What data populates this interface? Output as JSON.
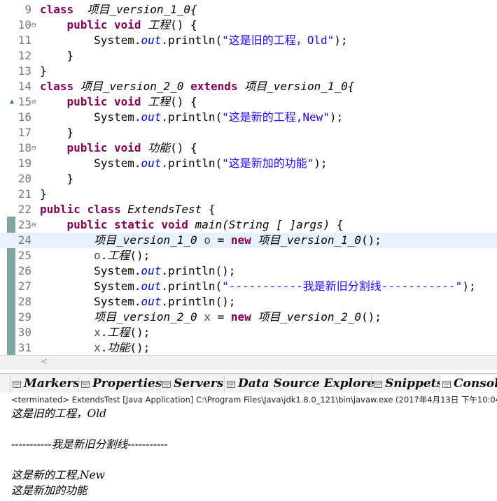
{
  "editor": {
    "lines": [
      {
        "n": "9",
        "fold": "",
        "segs": [
          [
            "kw",
            "class"
          ],
          [
            "",
            "  "
          ],
          [
            "it",
            "项目_version_1_0{"
          ]
        ]
      },
      {
        "n": "10",
        "fold": "⊖",
        "segs": [
          [
            "",
            "    "
          ],
          [
            "kw",
            "public"
          ],
          [
            "",
            " "
          ],
          [
            "kw",
            "void"
          ],
          [
            "",
            " "
          ],
          [
            "it",
            "工程"
          ],
          [
            "",
            "() {"
          ]
        ]
      },
      {
        "n": "11",
        "fold": "",
        "segs": [
          [
            "",
            "        System."
          ],
          [
            "fd",
            "out"
          ],
          [
            "",
            ".println("
          ],
          [
            "st",
            "\"这是旧的工程，Old\""
          ],
          [
            "",
            ");"
          ]
        ]
      },
      {
        "n": "12",
        "fold": "",
        "segs": [
          [
            "",
            "    }"
          ]
        ]
      },
      {
        "n": "13",
        "fold": "",
        "segs": [
          [
            "",
            "}"
          ]
        ]
      },
      {
        "n": "14",
        "fold": "",
        "segs": [
          [
            "kw",
            "class"
          ],
          [
            "",
            " "
          ],
          [
            "it",
            "项目_version_2_0"
          ],
          [
            "",
            " "
          ],
          [
            "kw",
            "extends"
          ],
          [
            "",
            " "
          ],
          [
            "it",
            "项目_version_1_0{"
          ]
        ]
      },
      {
        "n": "15",
        "fold": "⊖",
        "up": true,
        "segs": [
          [
            "",
            "    "
          ],
          [
            "kw",
            "public"
          ],
          [
            "",
            " "
          ],
          [
            "kw",
            "void"
          ],
          [
            "",
            " "
          ],
          [
            "it",
            "工程"
          ],
          [
            "",
            "() {"
          ]
        ]
      },
      {
        "n": "16",
        "fold": "",
        "segs": [
          [
            "",
            "        System."
          ],
          [
            "fd",
            "out"
          ],
          [
            "",
            ".println("
          ],
          [
            "st",
            "\"这是新的工程,New\""
          ],
          [
            "",
            ");"
          ]
        ]
      },
      {
        "n": "17",
        "fold": "",
        "segs": [
          [
            "",
            "    }"
          ]
        ]
      },
      {
        "n": "18",
        "fold": "⊖",
        "segs": [
          [
            "",
            "    "
          ],
          [
            "kw",
            "public"
          ],
          [
            "",
            " "
          ],
          [
            "kw",
            "void"
          ],
          [
            "",
            " "
          ],
          [
            "it",
            "功能"
          ],
          [
            "",
            "() {"
          ]
        ]
      },
      {
        "n": "19",
        "fold": "",
        "segs": [
          [
            "",
            "        System."
          ],
          [
            "fd",
            "out"
          ],
          [
            "",
            ".println("
          ],
          [
            "st",
            "\"这是新加的功能\""
          ],
          [
            "",
            ");"
          ]
        ]
      },
      {
        "n": "20",
        "fold": "",
        "segs": [
          [
            "",
            "    }"
          ]
        ]
      },
      {
        "n": "21",
        "fold": "",
        "segs": [
          [
            "",
            "}"
          ]
        ]
      },
      {
        "n": "22",
        "fold": "",
        "segs": [
          [
            "kw",
            "public"
          ],
          [
            "",
            " "
          ],
          [
            "kw",
            "class"
          ],
          [
            "",
            " "
          ],
          [
            "it",
            "ExtendsTest"
          ],
          [
            "",
            " {"
          ]
        ]
      },
      {
        "n": "23",
        "fold": "⊖",
        "segs": [
          [
            "",
            "    "
          ],
          [
            "kw",
            "public"
          ],
          [
            "",
            " "
          ],
          [
            "kw",
            "static"
          ],
          [
            "",
            " "
          ],
          [
            "kw",
            "void"
          ],
          [
            "",
            " "
          ],
          [
            "it",
            "main(String [ ]args)"
          ],
          [
            "",
            " {"
          ]
        ]
      },
      {
        "n": "24",
        "fold": "",
        "current": true,
        "segs": [
          [
            "",
            "        "
          ],
          [
            "it",
            "项目_version_1_0"
          ],
          [
            "",
            " "
          ],
          [
            "lv",
            "o"
          ],
          [
            "",
            " = "
          ],
          [
            "kw",
            "new"
          ],
          [
            "",
            " "
          ],
          [
            "it",
            "项目_version_1_0"
          ],
          [
            "",
            "();"
          ]
        ]
      },
      {
        "n": "25",
        "fold": "",
        "segs": [
          [
            "",
            "        "
          ],
          [
            "lv",
            "o"
          ],
          [
            "",
            "."
          ],
          [
            "it",
            "工程"
          ],
          [
            "",
            "();"
          ]
        ]
      },
      {
        "n": "26",
        "fold": "",
        "segs": [
          [
            "",
            "        System."
          ],
          [
            "fd",
            "out"
          ],
          [
            "",
            ".println();"
          ]
        ]
      },
      {
        "n": "27",
        "fold": "",
        "segs": [
          [
            "",
            "        System."
          ],
          [
            "fd",
            "out"
          ],
          [
            "",
            ".println("
          ],
          [
            "st",
            "\"-----------我是新旧分割线-----------\""
          ],
          [
            "",
            ");"
          ]
        ]
      },
      {
        "n": "28",
        "fold": "",
        "segs": [
          [
            "",
            "        System."
          ],
          [
            "fd",
            "out"
          ],
          [
            "",
            ".println();"
          ]
        ]
      },
      {
        "n": "29",
        "fold": "",
        "segs": [
          [
            "",
            "        "
          ],
          [
            "it",
            "项目_version_2_0"
          ],
          [
            "",
            " "
          ],
          [
            "lv",
            "x"
          ],
          [
            "",
            " = "
          ],
          [
            "kw",
            "new"
          ],
          [
            "",
            " "
          ],
          [
            "it",
            "项目_version_2_0"
          ],
          [
            "",
            "();"
          ]
        ]
      },
      {
        "n": "30",
        "fold": "",
        "segs": [
          [
            "",
            "        "
          ],
          [
            "lv",
            "x"
          ],
          [
            "",
            "."
          ],
          [
            "it",
            "工程"
          ],
          [
            "",
            "();"
          ]
        ]
      },
      {
        "n": "31",
        "fold": "",
        "segs": [
          [
            "",
            "        "
          ],
          [
            "lv",
            "x"
          ],
          [
            "",
            "."
          ],
          [
            "it",
            "功能"
          ],
          [
            "",
            "();"
          ]
        ]
      }
    ]
  },
  "scrollbar": {
    "left_arrow": "<"
  },
  "views": {
    "tabs": [
      {
        "label": "Markers",
        "icon": "markers-icon"
      },
      {
        "label": "Properties",
        "icon": "properties-icon"
      },
      {
        "label": "Servers",
        "icon": "servers-icon"
      },
      {
        "label": "Data Source Explorer",
        "icon": "data-source-icon"
      },
      {
        "label": "Snippets",
        "icon": "snippets-icon"
      },
      {
        "label": "Consol",
        "icon": "console-icon",
        "active": true
      }
    ]
  },
  "console": {
    "header": "<terminated> ExtendsTest [Java Application] C:\\Program Files\\Java\\jdk1.8.0_121\\bin\\javaw.exe (2017年4月13日 下午10:04",
    "output": [
      "这是旧的工程，Old",
      "",
      "-----------我是新旧分割线-----------",
      "",
      "这是新的工程,New",
      "这是新加的功能"
    ]
  },
  "colors": {
    "keyword": "#7f0055",
    "string": "#2a00ff",
    "field": "#0000c0",
    "local_var": "#6a3e3e",
    "current_line": "#e8f2fe"
  }
}
